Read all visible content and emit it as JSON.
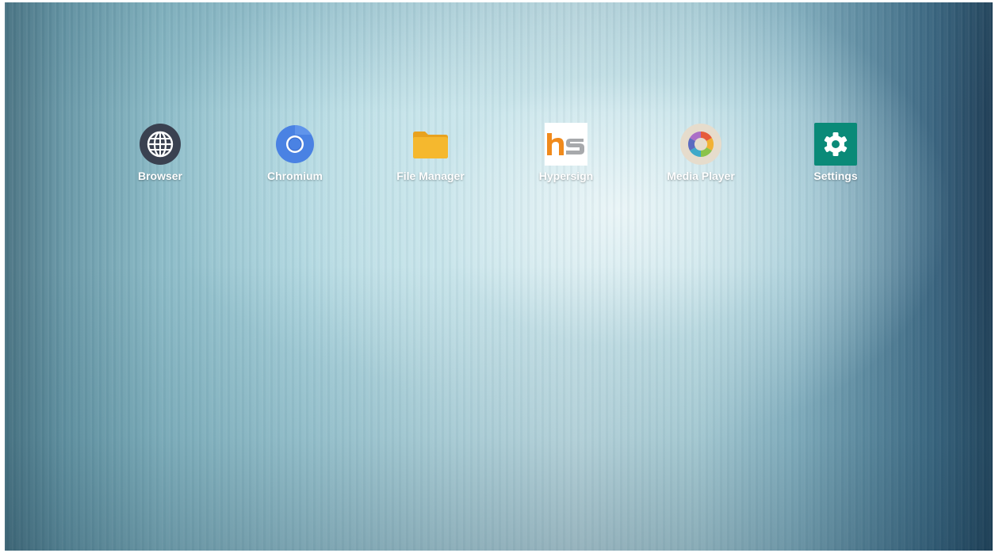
{
  "desktop": {
    "apps": [
      {
        "label": "Browser",
        "icon": "globe-icon"
      },
      {
        "label": "Chromium",
        "icon": "chromium-icon"
      },
      {
        "label": "File Manager",
        "icon": "folder-icon"
      },
      {
        "label": "Hypersign",
        "icon": "hypersign-logo-icon",
        "logo_text": "hs"
      },
      {
        "label": "Media Player",
        "icon": "media-player-icon"
      },
      {
        "label": "Settings",
        "icon": "gear-icon"
      }
    ]
  },
  "colors": {
    "settings_bg": "#0a8a78",
    "chromium_blue": "#4a82e3",
    "folder_yellow": "#f5b82e",
    "hypersign_orange": "#f08a1c",
    "browser_dark": "#3a4150"
  }
}
